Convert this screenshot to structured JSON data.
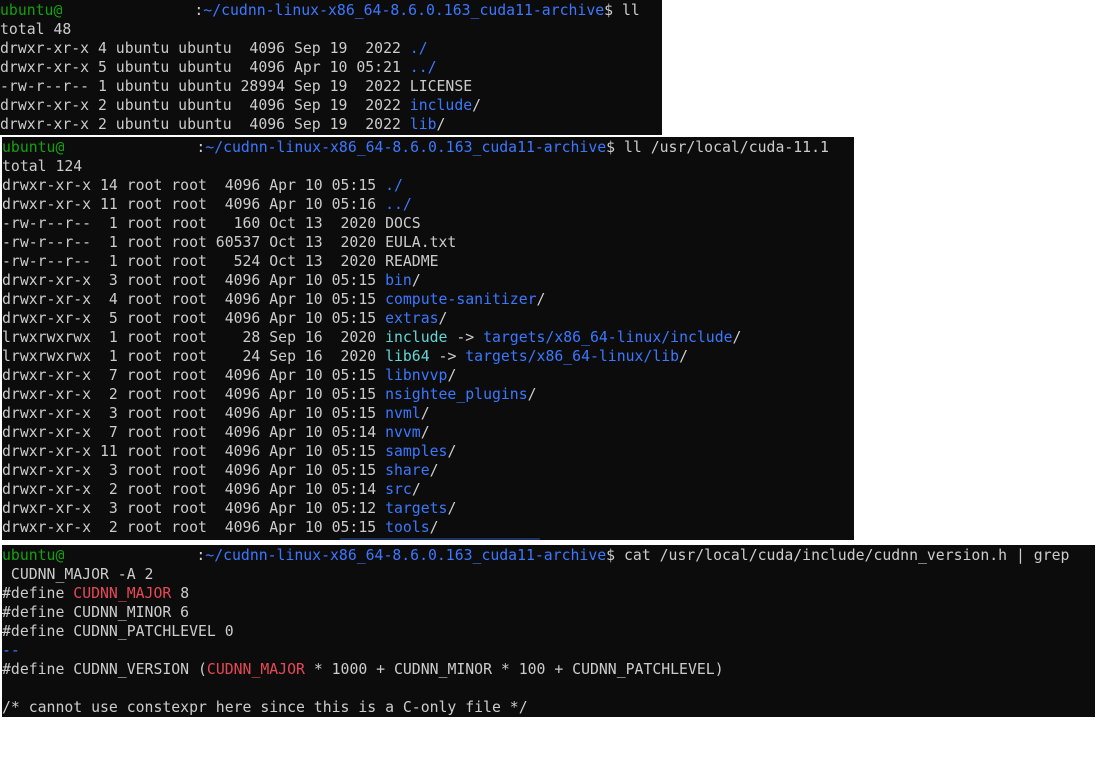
{
  "colors": {
    "terminal_bg": "#0c0c0c",
    "text": "#cccccc",
    "user_green": "#13a10e",
    "path_blue": "#3b78ff",
    "link_cyan": "#61d6d6",
    "match_red": "#e74856"
  },
  "prompt": {
    "user": "ubuntu@",
    "separator": ":",
    "cwd": "~/cudnn-linux-x86_64-8.6.0.163_cuda11-archive",
    "symbol": "$"
  },
  "session1": {
    "command": " ll",
    "total": "total 48",
    "entries": [
      {
        "meta": "drwxr-xr-x 4 ubuntu ubuntu  4096 Sep 19  2022 ",
        "name": "./",
        "kind": "dir"
      },
      {
        "meta": "drwxr-xr-x 5 ubuntu ubuntu  4096 Apr 10 05:21 ",
        "name": "../",
        "kind": "dir"
      },
      {
        "meta": "-rw-r--r-- 1 ubuntu ubuntu 28994 Sep 19  2022 ",
        "name": "LICENSE",
        "kind": "file"
      },
      {
        "meta": "drwxr-xr-x 2 ubuntu ubuntu  4096 Sep 19  2022 ",
        "name": "include",
        "suffix": "/",
        "kind": "dir"
      },
      {
        "meta": "drwxr-xr-x 2 ubuntu ubuntu  4096 Sep 19  2022 ",
        "name": "lib",
        "suffix": "/",
        "kind": "dir"
      }
    ]
  },
  "session2": {
    "command": " ll /usr/local/cuda-11.1",
    "total": "total 124",
    "entries": [
      {
        "meta": "drwxr-xr-x 14 root root  4096 Apr 10 05:15 ",
        "name": "./",
        "kind": "dir"
      },
      {
        "meta": "drwxr-xr-x 11 root root  4096 Apr 10 05:16 ",
        "name": "../",
        "kind": "dir"
      },
      {
        "meta": "-rw-r--r--  1 root root   160 Oct 13  2020 ",
        "name": "DOCS",
        "kind": "file"
      },
      {
        "meta": "-rw-r--r--  1 root root 60537 Oct 13  2020 ",
        "name": "EULA.txt",
        "kind": "file"
      },
      {
        "meta": "-rw-r--r--  1 root root   524 Oct 13  2020 ",
        "name": "README",
        "kind": "file"
      },
      {
        "meta": "drwxr-xr-x  3 root root  4096 Apr 10 05:15 ",
        "name": "bin",
        "suffix": "/",
        "kind": "dir"
      },
      {
        "meta": "drwxr-xr-x  4 root root  4096 Apr 10 05:15 ",
        "name": "compute-sanitizer",
        "suffix": "/",
        "kind": "dir"
      },
      {
        "meta": "drwxr-xr-x  5 root root  4096 Apr 10 05:15 ",
        "name": "extras",
        "suffix": "/",
        "kind": "dir"
      },
      {
        "meta": "lrwxrwxrwx  1 root root    28 Sep 16  2020 ",
        "name": "include",
        "arrow": " -> ",
        "target": "targets/x86_64-linux/include",
        "suffix": "/",
        "kind": "link"
      },
      {
        "meta": "lrwxrwxrwx  1 root root    24 Sep 16  2020 ",
        "name": "lib64",
        "arrow": " -> ",
        "target": "targets/x86_64-linux/lib",
        "suffix": "/",
        "kind": "link"
      },
      {
        "meta": "drwxr-xr-x  7 root root  4096 Apr 10 05:15 ",
        "name": "libnvvp",
        "suffix": "/",
        "kind": "dir"
      },
      {
        "meta": "drwxr-xr-x  2 root root  4096 Apr 10 05:15 ",
        "name": "nsightee_plugins",
        "suffix": "/",
        "kind": "dir"
      },
      {
        "meta": "drwxr-xr-x  3 root root  4096 Apr 10 05:15 ",
        "name": "nvml",
        "suffix": "/",
        "kind": "dir"
      },
      {
        "meta": "drwxr-xr-x  7 root root  4096 Apr 10 05:14 ",
        "name": "nvvm",
        "suffix": "/",
        "kind": "dir"
      },
      {
        "meta": "drwxr-xr-x 11 root root  4096 Apr 10 05:15 ",
        "name": "samples",
        "suffix": "/",
        "kind": "dir"
      },
      {
        "meta": "drwxr-xr-x  3 root root  4096 Apr 10 05:15 ",
        "name": "share",
        "suffix": "/",
        "kind": "dir"
      },
      {
        "meta": "drwxr-xr-x  2 root root  4096 Apr 10 05:14 ",
        "name": "src",
        "suffix": "/",
        "kind": "dir"
      },
      {
        "meta": "drwxr-xr-x  3 root root  4096 Apr 10 05:12 ",
        "name": "targets",
        "suffix": "/",
        "kind": "dir"
      },
      {
        "meta": "drwxr-xr-x  2 root root  4096 Apr 10 05:15 ",
        "name": "tools",
        "suffix": "/",
        "kind": "dir"
      }
    ]
  },
  "session3": {
    "command": " cat /usr/local/cuda/include/cudnn_version.h | grep",
    "command_wrap": " CUDNN_MAJOR -A 2",
    "define_prefix": "#define ",
    "match": "CUDNN_MAJOR",
    "major_value": " 8",
    "minor_line": "#define CUDNN_MINOR 6",
    "patch_line": "#define CUDNN_PATCHLEVEL 0",
    "group_sep": "--",
    "version_prefix": "#define CUDNN_VERSION (",
    "version_suffix": " * 1000 + CUDNN_MINOR * 100 + CUDNN_PATCHLEVEL)",
    "blank": "",
    "comment": "/* cannot use constexpr here since this is a C-only file */"
  }
}
